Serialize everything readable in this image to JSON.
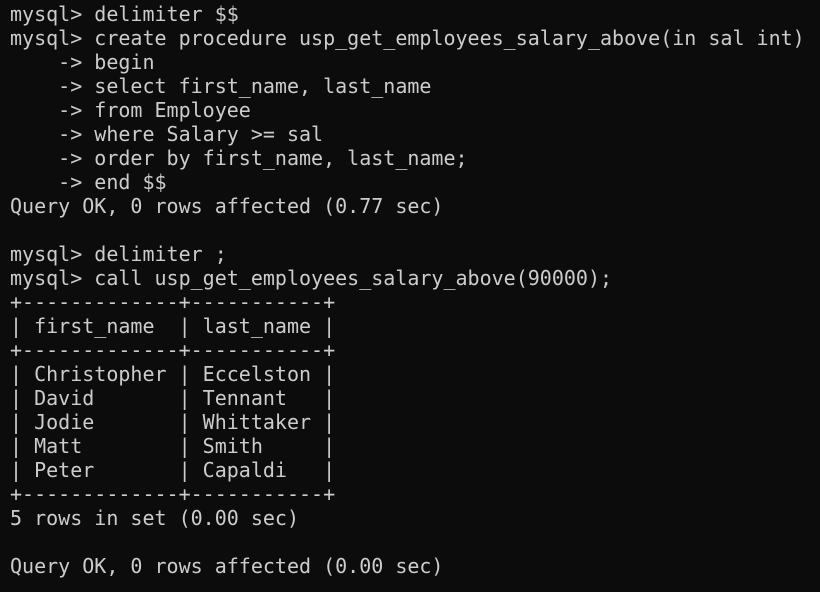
{
  "terminal": {
    "lines": [
      "mysql> delimiter $$",
      "mysql> create procedure usp_get_employees_salary_above(in sal int)",
      "    -> begin",
      "    -> select first_name, last_name",
      "    -> from Employee",
      "    -> where Salary >= sal",
      "    -> order by first_name, last_name;",
      "    -> end $$",
      "Query OK, 0 rows affected (0.77 sec)",
      "",
      "mysql> delimiter ;",
      "mysql> call usp_get_employees_salary_above(90000);",
      "+-------------+-----------+",
      "| first_name  | last_name |",
      "+-------------+-----------+",
      "| Christopher | Eccelston |",
      "| David       | Tennant   |",
      "| Jodie       | Whittaker |",
      "| Matt        | Smith     |",
      "| Peter       | Capaldi   |",
      "+-------------+-----------+",
      "5 rows in set (0.00 sec)",
      "",
      "Query OK, 0 rows affected (0.00 sec)"
    ]
  }
}
